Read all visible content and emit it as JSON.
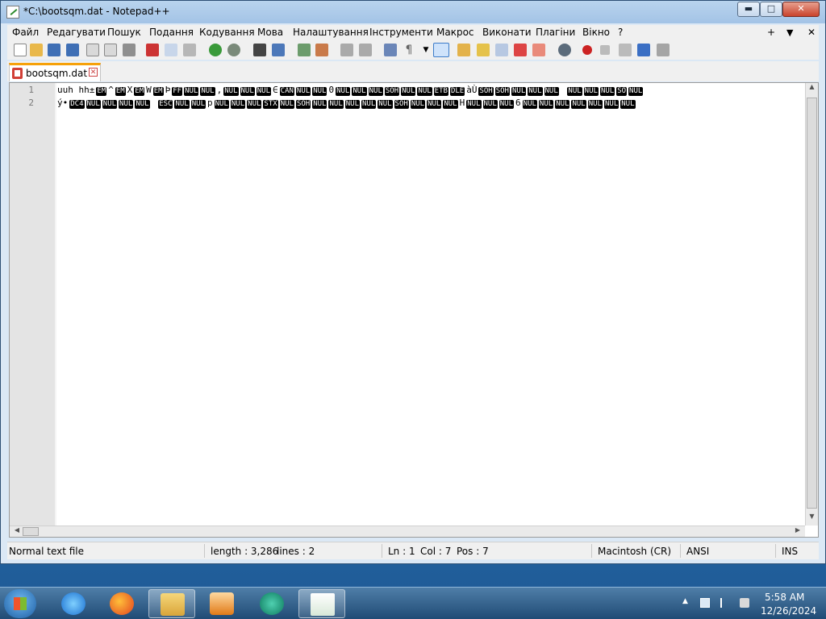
{
  "window": {
    "title": "*C:\\bootsqm.dat - Notepad++"
  },
  "titlebar_buttons": {
    "minimize": "▬",
    "maximize": "□",
    "close": "✕"
  },
  "menu": [
    "Файл",
    "Редагувати",
    "Пошук",
    "Подання",
    "Кодування",
    "Мова",
    "Налаштування",
    "Інструменти",
    "Макрос",
    "Виконати",
    "Плагіни",
    "Вікно",
    "?"
  ],
  "menu_right": {
    "plus": "+",
    "dropdown": "▼",
    "close": "✕"
  },
  "tab": {
    "label": "bootsqm.dat",
    "close": "✕"
  },
  "editor": {
    "line_numbers": [
      "1",
      "2"
    ],
    "line1_prefix": "uuh hh±",
    "line1_tokens": [
      "EM",
      "^",
      "EM",
      "X",
      "EM",
      "W",
      "EM",
      "Þ",
      "FF",
      "NUL",
      "NUL",
      ",",
      "NUL",
      "NUL",
      "NUL",
      "∈",
      "CAN",
      "NUL",
      "NUL",
      "0",
      "NUL",
      "NUL",
      "NUL",
      "SOH",
      "NUL",
      "NUL",
      "ETB",
      "DLE",
      "àÙ",
      "SOH",
      "SOH",
      "NUL",
      "NUL",
      "NUL",
      "",
      "NUL",
      "NUL",
      "NUL",
      "SO",
      "NUL"
    ],
    "line2_prefix": "ý•",
    "line2_tokens": [
      "DC4",
      "NUL",
      "NUL",
      "NUL",
      "NUL",
      "",
      "ESC",
      "NUL",
      "NUL",
      "p",
      "NUL",
      "NUL",
      "NUL",
      "STX",
      "NUL",
      "SOH",
      "NUL",
      "NUL",
      "NUL",
      "NUL",
      "NUL",
      "SOH",
      "NUL",
      "NUL",
      "NUL",
      "H",
      "NUL",
      "NUL",
      "NUL",
      "6",
      "NUL",
      "NUL",
      "NUL",
      "NUL",
      "NUL",
      "NUL",
      "NUL"
    ]
  },
  "status": {
    "file_type": "Normal text file",
    "length": "length : 3,286",
    "lines": "lines : 2",
    "ln": "Ln : 1",
    "col": "Col : 7",
    "pos": "Pos : 7",
    "eol": "Macintosh (CR)",
    "encoding": "ANSI",
    "mode": "INS"
  },
  "taskbar": {
    "apps": [
      "start",
      "internet-explorer",
      "firefox",
      "file-explorer",
      "media-player",
      "chat",
      "notepad-plus-plus"
    ],
    "clock_time": "5:58 AM",
    "clock_date": "12/26/2024"
  },
  "colors": {
    "tab_accent": "#f6a10a",
    "control_char_bg": "#000000",
    "close_button": "#c9432c"
  }
}
